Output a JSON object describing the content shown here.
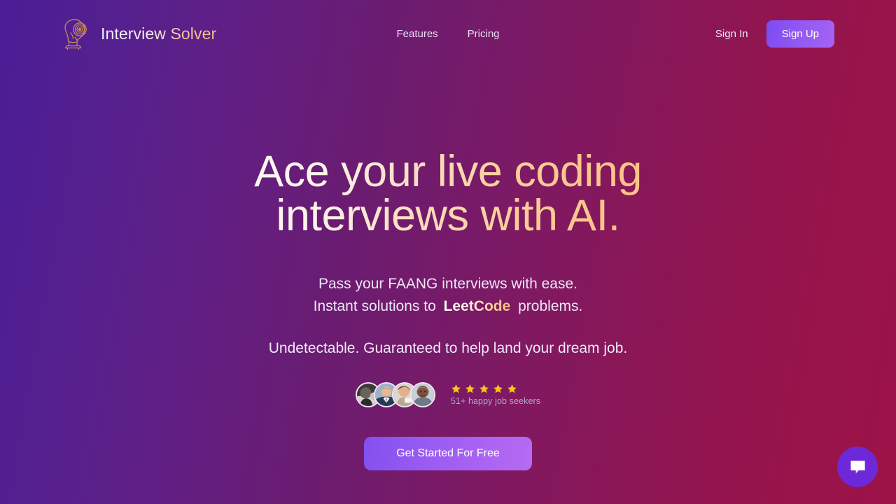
{
  "header": {
    "logo_icon": "thinker-brain-logo-icon",
    "brand_name_primary": "Interview ",
    "brand_name_secondary": "Solver",
    "nav": [
      {
        "label": "Features"
      },
      {
        "label": "Pricing"
      }
    ],
    "sign_in_label": "Sign In",
    "sign_up_label": "Sign Up"
  },
  "hero": {
    "title_line_1": "Ace your live coding",
    "title_line_2": "interviews with AI.",
    "subtitle_line_1": "Pass your FAANG interviews with ease.",
    "subtitle_line_2_prefix": "Instant solutions to ",
    "subtitle_highlight": "LeetCode",
    "subtitle_line_2_suffix": " problems.",
    "tagline": "Undetectable. Guaranteed to help land your dream job.",
    "cta_label": "Get Started For Free"
  },
  "social_proof": {
    "avatar_count": 4,
    "avatars": [
      {
        "alt": "happy job seeker avatar 1"
      },
      {
        "alt": "happy job seeker avatar 2"
      },
      {
        "alt": "happy job seeker avatar 3"
      },
      {
        "alt": "happy job seeker avatar 4"
      }
    ],
    "star_count": 5,
    "star_icon": "star-icon",
    "seekers_text": "51+ happy job seekers"
  },
  "chat": {
    "icon": "chat-bubble-icon",
    "aria_label": "Open chat"
  },
  "colors": {
    "bg_gradient_start": "#4a1d96",
    "bg_gradient_mid": "#6b1c70",
    "bg_gradient_end": "#9c1347",
    "accent_purple": "#9259f2",
    "star_gold": "#f5c518",
    "headline_gradient_start": "#fdf7f2",
    "headline_gradient_end": "#fcc286",
    "chat_bubble_bg": "#6d28d9"
  }
}
